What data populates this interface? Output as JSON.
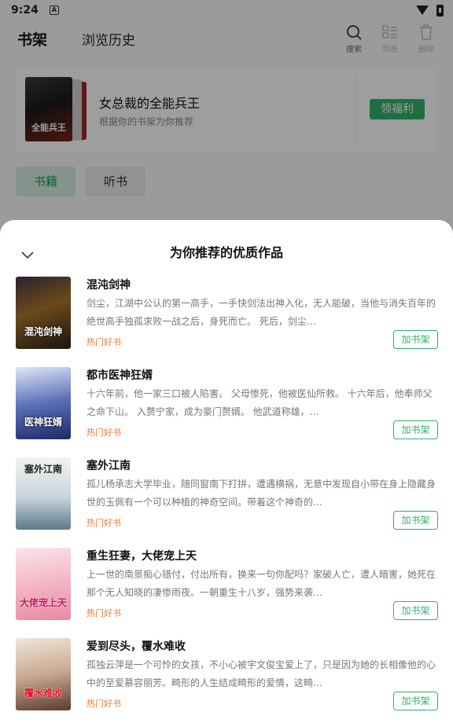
{
  "status_bar": {
    "time": "9:24",
    "app_icon": "A"
  },
  "header": {
    "tab_shelf": "书架",
    "tab_history": "浏览历史",
    "actions": [
      {
        "icon": "search-icon",
        "label": "搜索"
      },
      {
        "icon": "list-icon",
        "label": "列表"
      },
      {
        "icon": "trash-icon",
        "label": "删除"
      }
    ]
  },
  "recommend_card": {
    "title": "女总裁的全能兵王",
    "subtitle": "根据你的书架为你推荐",
    "cover_text": "全能兵王",
    "button": "领福利"
  },
  "segments": {
    "books": "书籍",
    "audio": "听书"
  },
  "sheet": {
    "title": "为你推荐的优质作品",
    "books": [
      {
        "title": "混沌剑神",
        "description": "剑尘，江湖中公认的第一高手，一手快剑法出神入化，无人能破，当他与消失百年的绝世高手独孤求败一战之后，身死而亡。 死后，剑尘…",
        "tag": "热门好书",
        "cover_text": "混沌剑神",
        "button": "加书架"
      },
      {
        "title": "都市医神狂婿",
        "description": "十六年前，他一家三口被人陷害。 父母惨死，他被医仙所救。 十六年后，他奉师父之命下山。 入赘宁家，成为豪门赘婿。 他武道称雄，…",
        "tag": "热门好书",
        "cover_text": "医神狂婿",
        "button": "加书架"
      },
      {
        "title": "塞外江南",
        "description": "孤儿杨承志大学毕业，随同窗南下打拼，遭遇横祸，无意中发现自小带在身上隐藏身世的玉佩有一个可以种植的神奇空间。带着这个神奇的…",
        "tag": "热门好书",
        "cover_text": "塞外江南",
        "button": "加书架"
      },
      {
        "title": "重生狂妻，大佬宠上天",
        "description": "上一世的南景痴心错付，付出所有，换来一句你配吗？家破人亡，遭人暗害，她死在那个无人知晓的凄惨雨夜。一朝重生十八岁，强势来袭…",
        "tag": "热门好书",
        "cover_text": "大佬宠上天",
        "button": "加书架"
      },
      {
        "title": "爱到尽头，覆水难收",
        "description": "孤独云萍是一个可怜的女孩，不小心被宇文俊宝爱上了，只是因为她的长相像他的心中的至爱慕容丽芳。畸形的人生结成畸形的爱情，这畸…",
        "tag": "热门好书",
        "cover_text": "覆水难收",
        "button": "加书架"
      }
    ]
  },
  "colors": {
    "accent": "#2fb36a",
    "tag": "#e8793a"
  }
}
